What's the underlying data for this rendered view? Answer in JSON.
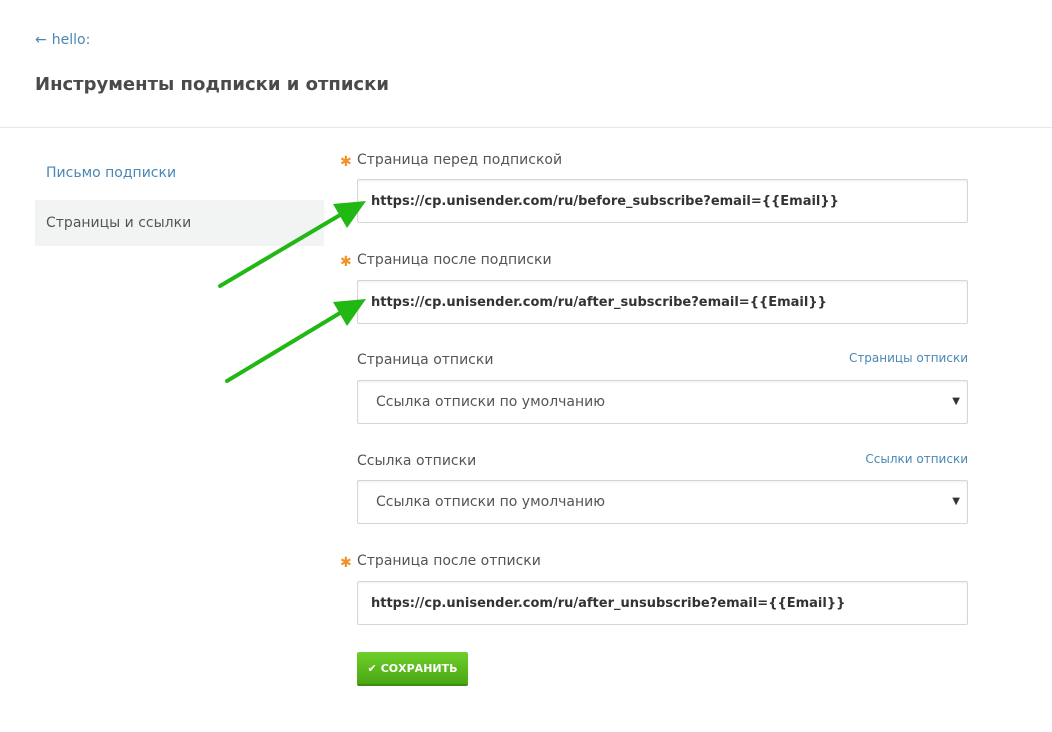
{
  "back": {
    "icon": "arrow-left-icon",
    "glyph": "←",
    "label": "hello:"
  },
  "page_title": "Инструменты подписки и отписки",
  "sidebar": {
    "items": [
      {
        "label": "Письмо подписки",
        "active": false
      },
      {
        "label": "Страницы и ссылки",
        "active": true
      }
    ]
  },
  "form": {
    "before_subscribe": {
      "label": "Страница перед подпиской",
      "required": "✱",
      "value": "https://cp.unisender.com/ru/before_subscribe?email={{Email}}"
    },
    "after_subscribe": {
      "label": "Страница после подписки",
      "required": "✱",
      "value": "https://cp.unisender.com/ru/after_subscribe?email={{Email}}"
    },
    "unsubscribe_page": {
      "label": "Страница отписки",
      "link": "Страницы отписки",
      "selected": "Ссылка отписки по умолчанию",
      "caret": "▼"
    },
    "unsubscribe_link": {
      "label": "Ссылка отписки",
      "link": "Ссылки отписки",
      "selected": "Ссылка отписки по умолчанию",
      "caret": "▼"
    },
    "after_unsubscribe": {
      "label": "Страница после отписки",
      "required": "✱",
      "value": "https://cp.unisender.com/ru/after_unsubscribe?email={{Email}}"
    },
    "save_label": "СОХРАНИТЬ",
    "save_icon": "✔"
  },
  "colors": {
    "link": "#4a87b5",
    "required": "#f0932b",
    "save": "#5bbd1f",
    "annotation_arrow": "#22b814"
  }
}
